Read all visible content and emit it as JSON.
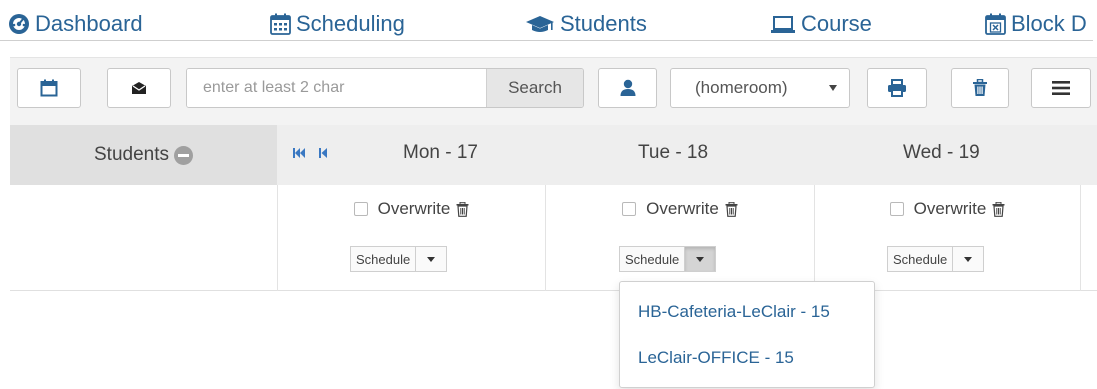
{
  "nav": {
    "items": [
      {
        "label": "Dashboard",
        "icon": "dashboard-icon"
      },
      {
        "label": "Scheduling",
        "icon": "calendar-icon"
      },
      {
        "label": "Students",
        "icon": "graduation-cap-icon"
      },
      {
        "label": "Course",
        "icon": "laptop-icon"
      },
      {
        "label": "Block D",
        "icon": "calendar-x-icon"
      }
    ]
  },
  "toolbar": {
    "calendar_icon": "calendar-icon",
    "envelope_icon": "envelope-icon",
    "search": {
      "placeholder": "enter at least 2 char",
      "value": "",
      "button_label": "Search"
    },
    "user_icon": "user-icon",
    "homeroom_select": {
      "value": "(homeroom)"
    },
    "print_icon": "print-icon",
    "trash_icon": "trash-icon",
    "menu_icon": "menu-icon"
  },
  "grid": {
    "students_header": "Students",
    "days": [
      {
        "label": "Mon - 17",
        "overwrite_label": "Overwrite",
        "schedule_label": "Schedule"
      },
      {
        "label": "Tue - 18",
        "overwrite_label": "Overwrite",
        "schedule_label": "Schedule"
      },
      {
        "label": "Wed - 19",
        "overwrite_label": "Overwrite",
        "schedule_label": "Schedule"
      }
    ]
  },
  "dropdown": {
    "items": [
      "HB-Cafeteria-LeClair - 15",
      "LeClair-OFFICE - 15"
    ]
  },
  "colors": {
    "link": "#2a6496",
    "header_bg": "#eeeeee",
    "students_bg": "#e0e0e0",
    "toolbar_bg": "#f3f3f3",
    "icon_blue": "#2a6496"
  }
}
